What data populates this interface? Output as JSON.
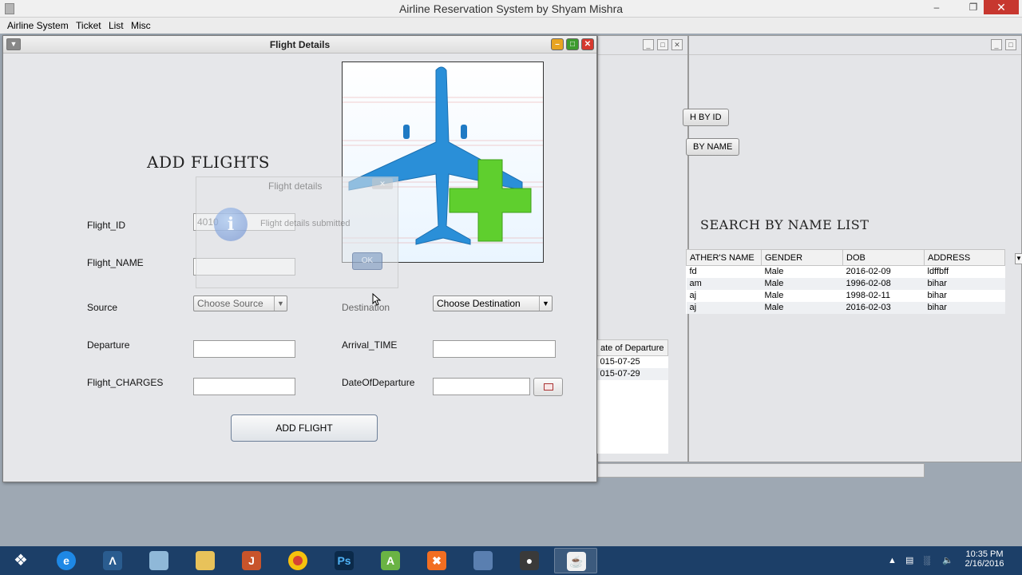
{
  "app": {
    "title": "Airline Reservation System by Shyam Mishra",
    "menu": [
      "Airline System",
      "Ticket",
      "List",
      "Misc"
    ]
  },
  "search_frame": {
    "by_id_button": "H BY ID",
    "by_name_button": "BY NAME",
    "heading": "SEARCH BY NAME LIST",
    "columns": [
      "ATHER'S NAME",
      "GENDER",
      "DOB",
      "ADDRESS"
    ],
    "rows": [
      [
        "fd",
        "Male",
        "2016-02-09",
        "ldffbff"
      ],
      [
        "am",
        "Male",
        "1996-02-08",
        "bihar"
      ],
      [
        "aj",
        "Male",
        "1998-02-11",
        "bihar"
      ],
      [
        "aj",
        "Male",
        "2016-02-03",
        "bihar"
      ]
    ]
  },
  "flight_list_frame": {
    "column": "ate of Departure",
    "rows": [
      "015-07-25",
      "015-07-29"
    ]
  },
  "flight_details": {
    "window_title": "Flight Details",
    "heading": "ADD FLIGHTS",
    "flight_id_label": "Flight_ID",
    "flight_id_value": "4010",
    "flight_name_label": "Flight_NAME",
    "source_label": "Source",
    "source_value": "Choose Source",
    "destination_label": "Destination",
    "destination_value": "Choose Destination",
    "departure_label": "Departure",
    "arrival_label": "Arrival_TIME",
    "charges_label": "Flight_CHARGES",
    "date_label": "DateOfDeparture",
    "add_button": "ADD FLIGHT"
  },
  "dialog": {
    "title": "Flight details",
    "message": "Flight details submitted",
    "ok_label": "OK"
  },
  "taskbar": {
    "time": "10:35 PM",
    "date": "2/16/2016"
  },
  "colors": {
    "taskbar": "#1c3f68",
    "minimize": "#e8a420",
    "maximize": "#3e9b2f",
    "close": "#d6382e",
    "plane": "#2a8fd8",
    "plus": "#5fcf2e"
  }
}
